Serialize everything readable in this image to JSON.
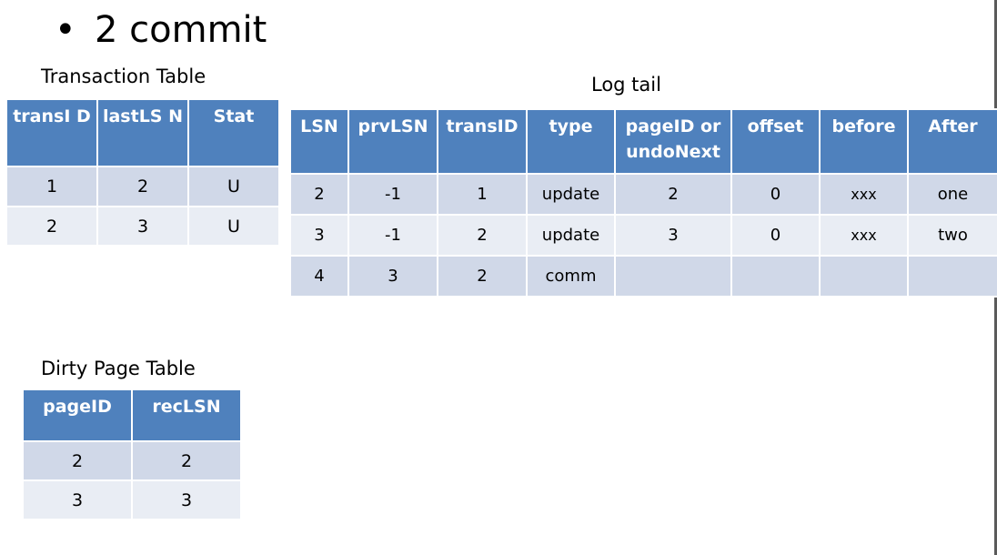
{
  "slide": {
    "bullet": "•",
    "title": "2 commit"
  },
  "transaction_table": {
    "caption": "Transaction Table",
    "headers": [
      "transI D",
      "lastLS N",
      "Stat"
    ],
    "rows": [
      [
        "1",
        "2",
        "U"
      ],
      [
        "2",
        "3",
        "U"
      ]
    ]
  },
  "log_tail": {
    "caption": "Log tail",
    "headers": [
      "LSN",
      "prvLSN",
      "transID",
      "type",
      "pageID or undoNext",
      "offset",
      "before",
      "After"
    ],
    "rows": [
      [
        "2",
        "-1",
        "1",
        "update",
        "2",
        "0",
        "xxx",
        "one"
      ],
      [
        "3",
        "-1",
        "2",
        "update",
        "3",
        "0",
        "xxx",
        "two"
      ],
      [
        "4",
        "3",
        "2",
        "comm",
        "",
        "",
        "",
        ""
      ]
    ]
  },
  "dirty_page_table": {
    "caption": "Dirty Page Table",
    "headers": [
      "pageID",
      "recLSN"
    ],
    "rows": [
      [
        "2",
        "2"
      ],
      [
        "3",
        "3"
      ]
    ]
  }
}
